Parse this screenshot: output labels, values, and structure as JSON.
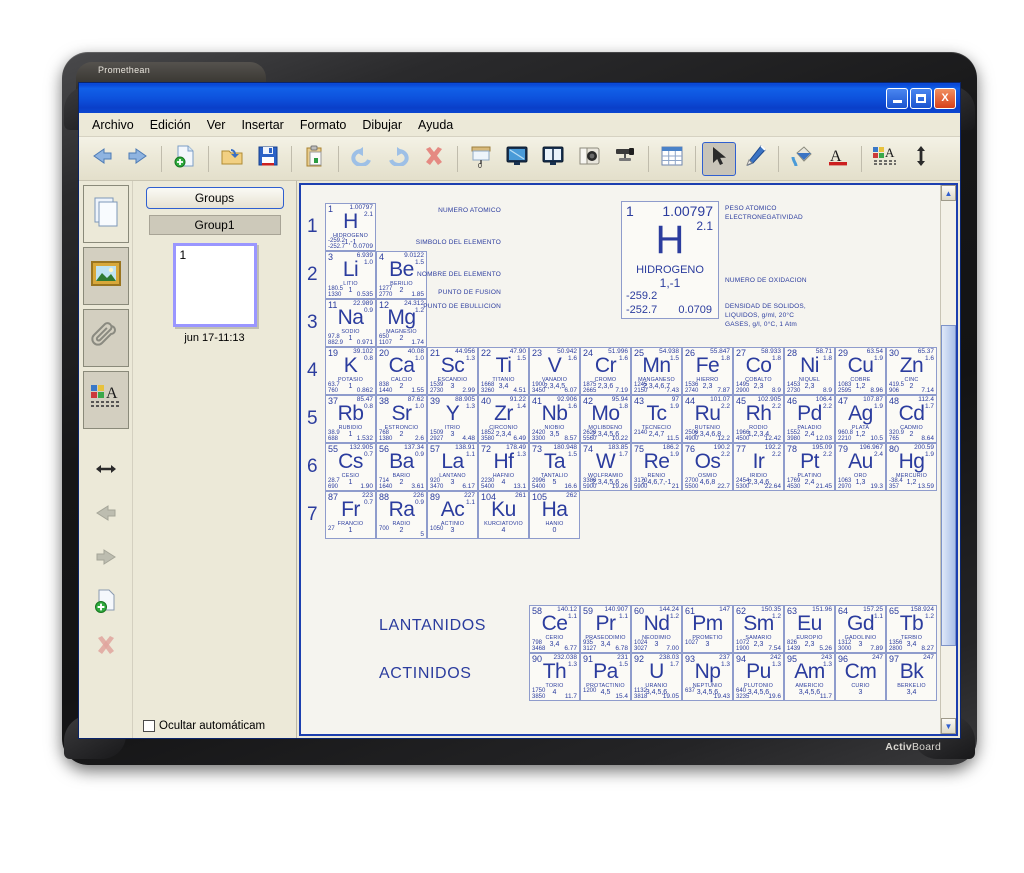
{
  "board": {
    "brand_top": "Promethean",
    "brand_bottom_bold": "Activ",
    "brand_bottom_rest": "Board"
  },
  "window": {
    "title": "",
    "buttons": {
      "minimize": "minimize-button",
      "maximize": "maximize-button",
      "close": "X"
    }
  },
  "menu": {
    "items": [
      "Archivo",
      "Edición",
      "Ver",
      "Insertar",
      "Formato",
      "Dibujar",
      "Ayuda"
    ]
  },
  "toolbar": {
    "items": [
      {
        "name": "back-arrow",
        "glyph": "←"
      },
      {
        "name": "forward-arrow",
        "glyph": "→"
      },
      {
        "name": "new-page",
        "glyph": "⊕"
      },
      {
        "name": "open-folder",
        "glyph": "↻"
      },
      {
        "name": "save-disk",
        "glyph": "▣"
      },
      {
        "name": "paste-clipboard",
        "glyph": "⎘"
      },
      {
        "name": "undo",
        "glyph": "↶"
      },
      {
        "name": "redo",
        "glyph": "↷"
      },
      {
        "name": "delete",
        "glyph": "✕"
      },
      {
        "name": "presentation-screen",
        "glyph": "▭"
      },
      {
        "name": "desktop-annotate",
        "glyph": "▣"
      },
      {
        "name": "dual-page-view",
        "glyph": "◫"
      },
      {
        "name": "camera-snapshot",
        "glyph": "◉"
      },
      {
        "name": "projector",
        "glyph": "▬"
      },
      {
        "name": "grid-table",
        "glyph": "⊞"
      },
      {
        "name": "select-pointer",
        "glyph": "➤"
      },
      {
        "name": "pen-tool",
        "glyph": "✒"
      },
      {
        "name": "fill-bucket",
        "glyph": "◖"
      },
      {
        "name": "text-color",
        "glyph": "A"
      },
      {
        "name": "text-style",
        "glyph": "A"
      },
      {
        "name": "resize-vertical",
        "glyph": "↕"
      }
    ]
  },
  "dock": {
    "tabs": [
      {
        "name": "pages-tab",
        "glyph": "❐"
      },
      {
        "name": "resources-tab",
        "glyph": "⛰"
      },
      {
        "name": "attachments-tab",
        "glyph": "Ὄe"
      },
      {
        "name": "annotations-tab",
        "glyph": "A"
      }
    ],
    "actions": [
      {
        "name": "resize-handle",
        "glyph": "↔"
      },
      {
        "name": "previous-page",
        "glyph": "←"
      },
      {
        "name": "next-page",
        "glyph": "→"
      },
      {
        "name": "add-page",
        "glyph": "⊕"
      },
      {
        "name": "delete-page",
        "glyph": "✕"
      }
    ]
  },
  "panel": {
    "groups_button": "Groups",
    "group_name": "Group1",
    "thumbnail_number": "1",
    "thumbnail_label": "jun 17-11:13",
    "autohide_label": "Ocultar automáticam",
    "autohide_checked": false
  },
  "scrollbar": {
    "up": "▲",
    "down": "▼"
  },
  "chart_data": {
    "type": "table",
    "title": "Tabla Periódica de los Elementos",
    "language": "es",
    "legend": {
      "atomic_number": "1",
      "atomic_mass": "1.00797",
      "electronegativity": "2.1",
      "symbol": "H",
      "name": "HIDROGENO",
      "oxidation": "1,-1",
      "melting_point": "-259.2",
      "boiling_point": "-252.7",
      "density": "0.0709",
      "captions": {
        "atomic_number": "NUMERO ATOMICO",
        "symbol": "SIMBOLO DEL ELEMENTO",
        "name": "NOMBRE DEL ELEMENTO",
        "melting": "PUNTO DE FUSION",
        "boiling": "PUNTO DE EBULLICION",
        "mass": "PESO ATOMICO",
        "electronegativity": "ELECTRONEGATIVIDAD",
        "oxidation": "NUMERO DE OXIDACION",
        "density_line1": "DENSIDAD DE SOLIDOS,",
        "density_line2": "LIQUIDOS, g/ml, 20°C",
        "density_line3": "GASES, g/l, 0°C, 1 Atm"
      }
    },
    "period_labels": [
      "1",
      "2",
      "3",
      "4",
      "5",
      "6",
      "7"
    ],
    "series_labels": {
      "lanthanides": "LANTANIDOS",
      "actinides": "ACTINIDOS"
    },
    "elements": [
      {
        "z": "1",
        "sym": "H",
        "name": "HIDROGENO",
        "mass": "1.00797",
        "en": "2.1",
        "ox": "1,-1",
        "mp": "-259.2",
        "bp": "-252.7",
        "d": "0.0709",
        "row": 1,
        "col": 1
      },
      {
        "z": "3",
        "sym": "Li",
        "name": "LITIO",
        "mass": "6.939",
        "en": "1.0",
        "ox": "1",
        "mp": "180.5",
        "bp": "1330",
        "d": "0.535",
        "row": 2,
        "col": 1
      },
      {
        "z": "4",
        "sym": "Be",
        "name": "BERILIO",
        "mass": "9.0122",
        "en": "1.5",
        "ox": "2",
        "mp": "1277",
        "bp": "2770",
        "d": "1.85",
        "row": 2,
        "col": 2
      },
      {
        "z": "11",
        "sym": "Na",
        "name": "SODIO",
        "mass": "22.989",
        "en": "0.9",
        "ox": "1",
        "mp": "97.8",
        "bp": "882.9",
        "d": "0.971",
        "row": 3,
        "col": 1
      },
      {
        "z": "12",
        "sym": "Mg",
        "name": "MAGNESIO",
        "mass": "24.312",
        "en": "1.2",
        "ox": "2",
        "mp": "650",
        "bp": "1107",
        "d": "1.74",
        "row": 3,
        "col": 2
      },
      {
        "z": "19",
        "sym": "K",
        "name": "POTASIO",
        "mass": "39.102",
        "en": "0.8",
        "ox": "1",
        "mp": "63.7",
        "bp": "760",
        "d": "0.862",
        "row": 4,
        "col": 1
      },
      {
        "z": "20",
        "sym": "Ca",
        "name": "CALCIO",
        "mass": "40.08",
        "en": "1.0",
        "ox": "2",
        "mp": "838",
        "bp": "1440",
        "d": "1.55",
        "row": 4,
        "col": 2
      },
      {
        "z": "21",
        "sym": "Sc",
        "name": "ESCANDIO",
        "mass": "44.956",
        "en": "1.3",
        "ox": "3",
        "mp": "1539",
        "bp": "2730",
        "d": "2.99",
        "row": 4,
        "col": 3
      },
      {
        "z": "22",
        "sym": "Ti",
        "name": "TITANIO",
        "mass": "47.90",
        "en": "1.5",
        "ox": "3,4",
        "mp": "1668",
        "bp": "3260",
        "d": "4.51",
        "row": 4,
        "col": 4
      },
      {
        "z": "23",
        "sym": "V",
        "name": "VANADIO",
        "mass": "50.942",
        "en": "1.6",
        "ox": "2,3,4,5",
        "mp": "1900",
        "bp": "3450",
        "d": "6.07",
        "row": 4,
        "col": 5
      },
      {
        "z": "24",
        "sym": "Cr",
        "name": "CROMO",
        "mass": "51.996",
        "en": "1.6",
        "ox": "2,3,6",
        "mp": "1875",
        "bp": "2665",
        "d": "7.19",
        "row": 4,
        "col": 6
      },
      {
        "z": "25",
        "sym": "Mn",
        "name": "MANGANESO",
        "mass": "54.938",
        "en": "1.5",
        "ox": "2,3,4,6,7",
        "mp": "1245",
        "bp": "2150",
        "d": "7.43",
        "row": 4,
        "col": 7
      },
      {
        "z": "26",
        "sym": "Fe",
        "name": "HIERRO",
        "mass": "55.847",
        "en": "1.8",
        "ox": "2,3",
        "mp": "1536",
        "bp": "2740",
        "d": "7.87",
        "row": 4,
        "col": 8
      },
      {
        "z": "27",
        "sym": "Co",
        "name": "COBALTO",
        "mass": "58.933",
        "en": "1.8",
        "ox": "2,3",
        "mp": "1495",
        "bp": "2900",
        "d": "8.9",
        "row": 4,
        "col": 9
      },
      {
        "z": "28",
        "sym": "Ni",
        "name": "NIQUEL",
        "mass": "58.71",
        "en": "1.8",
        "ox": "2,3",
        "mp": "1453",
        "bp": "2730",
        "d": "8.9",
        "row": 4,
        "col": 10
      },
      {
        "z": "29",
        "sym": "Cu",
        "name": "COBRE",
        "mass": "63.54",
        "en": "1.9",
        "ox": "1,2",
        "mp": "1083",
        "bp": "2595",
        "d": "8.96",
        "row": 4,
        "col": 11
      },
      {
        "z": "30",
        "sym": "Zn",
        "name": "CINC",
        "mass": "65.37",
        "en": "1.6",
        "ox": "2",
        "mp": "419.5",
        "bp": "906",
        "d": "7.14",
        "row": 4,
        "col": 12
      },
      {
        "z": "37",
        "sym": "Rb",
        "name": "RUBIDIO",
        "mass": "85.47",
        "en": "0.8",
        "ox": "1",
        "mp": "38.9",
        "bp": "688",
        "d": "1.532",
        "row": 5,
        "col": 1
      },
      {
        "z": "38",
        "sym": "Sr",
        "name": "ESTRONCIO",
        "mass": "87.62",
        "en": "1.0",
        "ox": "2",
        "mp": "768",
        "bp": "1380",
        "d": "2.6",
        "row": 5,
        "col": 2
      },
      {
        "z": "39",
        "sym": "Y",
        "name": "ITRIO",
        "mass": "88.905",
        "en": "1.3",
        "ox": "3",
        "mp": "1509",
        "bp": "2927",
        "d": "4.48",
        "row": 5,
        "col": 3
      },
      {
        "z": "40",
        "sym": "Zr",
        "name": "CIRCONIO",
        "mass": "91.22",
        "en": "1.4",
        "ox": "2,3,4",
        "mp": "1852",
        "bp": "3580",
        "d": "6.49",
        "row": 5,
        "col": 4
      },
      {
        "z": "41",
        "sym": "Nb",
        "name": "NIOBIO",
        "mass": "92.906",
        "en": "1.6",
        "ox": "3,5",
        "mp": "2420",
        "bp": "3300",
        "d": "8.57",
        "row": 5,
        "col": 5
      },
      {
        "z": "42",
        "sym": "Mo",
        "name": "MOLIBDENO",
        "mass": "95.94",
        "en": "1.8",
        "ox": "2,3,4,5,6",
        "mp": "2620",
        "bp": "5560",
        "d": "10.22",
        "row": 5,
        "col": 6
      },
      {
        "z": "43",
        "sym": "Tc",
        "name": "TECNECIO",
        "mass": "97",
        "en": "1.9",
        "ox": "2,4,7",
        "mp": "2140",
        "bp": "",
        "d": "11.5",
        "row": 5,
        "col": 7
      },
      {
        "z": "44",
        "sym": "Ru",
        "name": "RUTENIO",
        "mass": "101.07",
        "en": "2.2",
        "ox": "2,3,4,6,8",
        "mp": "2500",
        "bp": "4900",
        "d": "12.2",
        "row": 5,
        "col": 8
      },
      {
        "z": "45",
        "sym": "Rh",
        "name": "RODIO",
        "mass": "102.905",
        "en": "2.2",
        "ox": "1,2,3,4",
        "mp": "1966",
        "bp": "4500",
        "d": "12.42",
        "row": 5,
        "col": 9
      },
      {
        "z": "46",
        "sym": "Pd",
        "name": "PALADIO",
        "mass": "106.4",
        "en": "2.2",
        "ox": "2,4",
        "mp": "1552",
        "bp": "3980",
        "d": "12.03",
        "row": 5,
        "col": 10
      },
      {
        "z": "47",
        "sym": "Ag",
        "name": "PLATA",
        "mass": "107.87",
        "en": "1.9",
        "ox": "1,2",
        "mp": "960.8",
        "bp": "2210",
        "d": "10.5",
        "row": 5,
        "col": 11
      },
      {
        "z": "48",
        "sym": "Cd",
        "name": "CADMIO",
        "mass": "112.4",
        "en": "1.7",
        "ox": "2",
        "mp": "320.9",
        "bp": "765",
        "d": "8.64",
        "row": 5,
        "col": 12
      },
      {
        "z": "55",
        "sym": "Cs",
        "name": "CESIO",
        "mass": "132.905",
        "en": "0.7",
        "ox": "1",
        "mp": "28.7",
        "bp": "690",
        "d": "1.90",
        "row": 6,
        "col": 1
      },
      {
        "z": "56",
        "sym": "Ba",
        "name": "BARIO",
        "mass": "137.34",
        "en": "0.9",
        "ox": "2",
        "mp": "714",
        "bp": "1640",
        "d": "3.61",
        "row": 6,
        "col": 2
      },
      {
        "z": "57",
        "sym": "La",
        "name": "LANTANO",
        "mass": "138.91",
        "en": "1.1",
        "ox": "3",
        "mp": "920",
        "bp": "3470",
        "d": "6.17",
        "row": 6,
        "col": 3
      },
      {
        "z": "72",
        "sym": "Hf",
        "name": "HAFNIO",
        "mass": "178.49",
        "en": "1.3",
        "ox": "4",
        "mp": "2230",
        "bp": "5400",
        "d": "13.1",
        "row": 6,
        "col": 4
      },
      {
        "z": "73",
        "sym": "Ta",
        "name": "TANTALIO",
        "mass": "180.948",
        "en": "1.5",
        "ox": "5",
        "mp": "2996",
        "bp": "5400",
        "d": "16.6",
        "row": 6,
        "col": 5
      },
      {
        "z": "74",
        "sym": "W",
        "name": "WOLFRAMIO",
        "mass": "183.85",
        "en": "1.7",
        "ox": "2,3,4,5,6",
        "mp": "3380",
        "bp": "5900",
        "d": "19.26",
        "row": 6,
        "col": 6
      },
      {
        "z": "75",
        "sym": "Re",
        "name": "RENIO",
        "mass": "186.2",
        "en": "1.9",
        "ox": "2,4,6,7,-1",
        "mp": "3170",
        "bp": "5900",
        "d": "21",
        "row": 6,
        "col": 7
      },
      {
        "z": "76",
        "sym": "Os",
        "name": "OSMIO",
        "mass": "190.2",
        "en": "2.2",
        "ox": "4,6,8",
        "mp": "2700",
        "bp": "5500",
        "d": "22.7",
        "row": 6,
        "col": 8
      },
      {
        "z": "77",
        "sym": "Ir",
        "name": "IRIDIO",
        "mass": "192.2",
        "en": "2.2",
        "ox": "2,3,4,6",
        "mp": "2454",
        "bp": "5300",
        "d": "22.64",
        "row": 6,
        "col": 9
      },
      {
        "z": "78",
        "sym": "Pt",
        "name": "PLATINO",
        "mass": "195.09",
        "en": "2.2",
        "ox": "2,4",
        "mp": "1769",
        "bp": "4530",
        "d": "21.45",
        "row": 6,
        "col": 10
      },
      {
        "z": "79",
        "sym": "Au",
        "name": "ORO",
        "mass": "196.967",
        "en": "2.4",
        "ox": "1,3",
        "mp": "1063",
        "bp": "2970",
        "d": "19.3",
        "row": 6,
        "col": 11
      },
      {
        "z": "80",
        "sym": "Hg",
        "name": "MERCURIO",
        "mass": "200.59",
        "en": "1.9",
        "ox": "1,2",
        "mp": "-38.4",
        "bp": "357",
        "d": "13.59",
        "row": 6,
        "col": 12
      },
      {
        "z": "87",
        "sym": "Fr",
        "name": "FRANCIO",
        "mass": "223",
        "en": "0.7",
        "ox": "1",
        "mp": "27",
        "bp": "",
        "d": "",
        "row": 7,
        "col": 1
      },
      {
        "z": "88",
        "sym": "Ra",
        "name": "RADIO",
        "mass": "226",
        "en": "0.9",
        "ox": "2",
        "mp": "700",
        "bp": "",
        "d": "5",
        "row": 7,
        "col": 2
      },
      {
        "z": "89",
        "sym": "Ac",
        "name": "ACTINIO",
        "mass": "227",
        "en": "1.1",
        "ox": "3",
        "mp": "1050",
        "bp": "",
        "d": "",
        "row": 7,
        "col": 3
      },
      {
        "z": "104",
        "sym": "Ku",
        "name": "KURCIATOVIO",
        "mass": "261",
        "en": "",
        "ox": "4",
        "mp": "",
        "bp": "",
        "d": "",
        "row": 7,
        "col": 4
      },
      {
        "z": "105",
        "sym": "Ha",
        "name": "HANIO",
        "mass": "262",
        "en": "",
        "ox": "0",
        "mp": "",
        "bp": "",
        "d": "",
        "row": 7,
        "col": 5
      }
    ],
    "lanthanides": [
      {
        "z": "58",
        "sym": "Ce",
        "name": "CERIO",
        "mass": "140.12",
        "en": "1.1",
        "ox": "3,4",
        "mp": "798",
        "bp": "3468",
        "d": "6.77"
      },
      {
        "z": "59",
        "sym": "Pr",
        "name": "PRASEODIMIO",
        "mass": "140.907",
        "en": "1.1",
        "ox": "3,4",
        "mp": "935",
        "bp": "3127",
        "d": "6.78"
      },
      {
        "z": "60",
        "sym": "Nd",
        "name": "NEODIMIO",
        "mass": "144.24",
        "en": "1.2",
        "ox": "3",
        "mp": "1024",
        "bp": "3027",
        "d": "7.00"
      },
      {
        "z": "61",
        "sym": "Pm",
        "name": "PROMETIO",
        "mass": "147",
        "en": "",
        "ox": "3",
        "mp": "1027",
        "bp": "",
        "d": ""
      },
      {
        "z": "62",
        "sym": "Sm",
        "name": "SAMARIO",
        "mass": "150.35",
        "en": "1.2",
        "ox": "2,3",
        "mp": "1072",
        "bp": "1900",
        "d": "7.54"
      },
      {
        "z": "63",
        "sym": "Eu",
        "name": "EUROPIO",
        "mass": "151.96",
        "en": "",
        "ox": "2,3",
        "mp": "826",
        "bp": "1439",
        "d": "5.26"
      },
      {
        "z": "64",
        "sym": "Gd",
        "name": "GADOLINIO",
        "mass": "157.25",
        "en": "1.1",
        "ox": "3",
        "mp": "1312",
        "bp": "3000",
        "d": "7.89"
      },
      {
        "z": "65",
        "sym": "Tb",
        "name": "TERBIO",
        "mass": "158.924",
        "en": "1.2",
        "ox": "3,4",
        "mp": "1356",
        "bp": "2800",
        "d": "8.27"
      }
    ],
    "actinides": [
      {
        "z": "90",
        "sym": "Th",
        "name": "TORIO",
        "mass": "232.038",
        "en": "1.3",
        "ox": "4",
        "mp": "1750",
        "bp": "3850",
        "d": "11.7"
      },
      {
        "z": "91",
        "sym": "Pa",
        "name": "PROTACTINIO",
        "mass": "231",
        "en": "1.5",
        "ox": "4,5",
        "mp": "1200",
        "bp": "",
        "d": "15.4"
      },
      {
        "z": "92",
        "sym": "U",
        "name": "URANIO",
        "mass": "238.03",
        "en": "1.7",
        "ox": "3,4,5,6",
        "mp": "1132",
        "bp": "3818",
        "d": "19.05"
      },
      {
        "z": "93",
        "sym": "Np",
        "name": "NEPTUNIO",
        "mass": "237",
        "en": "1.3",
        "ox": "3,4,5,6",
        "mp": "637",
        "bp": "",
        "d": "19.43"
      },
      {
        "z": "94",
        "sym": "Pu",
        "name": "PLUTONIO",
        "mass": "242",
        "en": "1.3",
        "ox": "3,4,5,6",
        "mp": "640",
        "bp": "3235",
        "d": "19.6"
      },
      {
        "z": "95",
        "sym": "Am",
        "name": "AMERICIO",
        "mass": "243",
        "en": "1.3",
        "ox": "3,4,5,6",
        "mp": "",
        "bp": "",
        "d": "11.7"
      },
      {
        "z": "96",
        "sym": "Cm",
        "name": "CURIO",
        "mass": "247",
        "en": "",
        "ox": "3",
        "mp": "",
        "bp": "",
        "d": ""
      },
      {
        "z": "97",
        "sym": "Bk",
        "name": "BERKELIO",
        "mass": "247",
        "en": "",
        "ox": "3,4",
        "mp": "",
        "bp": "",
        "d": ""
      }
    ]
  }
}
